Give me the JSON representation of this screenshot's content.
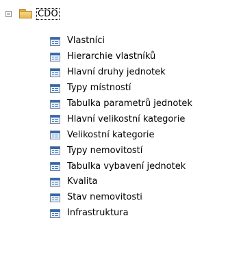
{
  "tree": {
    "root": {
      "label": "CDO",
      "expanded": true,
      "icon": "folder-icon"
    },
    "items": [
      {
        "label": "Vlastníci",
        "icon": "table-icon"
      },
      {
        "label": "Hierarchie vlastníků",
        "icon": "table-icon"
      },
      {
        "label": "Hlavní druhy jednotek",
        "icon": "table-icon"
      },
      {
        "label": "Typy místností",
        "icon": "table-icon"
      },
      {
        "label": "Tabulka parametrů jednotek",
        "icon": "table-icon"
      },
      {
        "label": "Hlavní velikostní kategorie",
        "icon": "table-icon"
      },
      {
        "label": "Velikostní kategorie",
        "icon": "table-icon"
      },
      {
        "label": "Typy nemovitostí",
        "icon": "table-icon"
      },
      {
        "label": "Tabulka vybavení jednotek",
        "icon": "table-icon"
      },
      {
        "label": "Kvalita",
        "icon": "table-icon"
      },
      {
        "label": "Stav nemovitosti",
        "icon": "table-icon"
      },
      {
        "label": "Infrastruktura",
        "icon": "table-icon"
      }
    ]
  },
  "colors": {
    "folder": "#eab84e",
    "table_header": "#2e66b3",
    "table_background": "#e9eff7"
  }
}
